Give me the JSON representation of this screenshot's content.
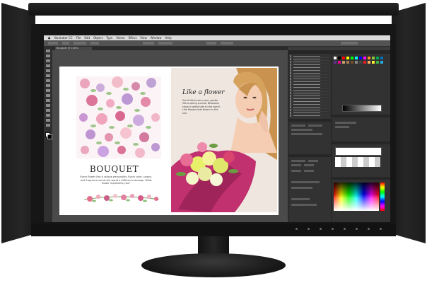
{
  "app": {
    "menu": [
      "Illustrator CC",
      "File",
      "Edit",
      "Object",
      "Type",
      "Select",
      "Effect",
      "View",
      "Window",
      "Help"
    ],
    "document_tab": "Bouquet @ 100%"
  },
  "document": {
    "left_page": {
      "title": "BOUQUET",
      "body": "Every flower has a unique personality. Every color, shape, and fragrance sends the world a different message. What flower represents you?"
    },
    "right_page": {
      "script_title": "Like a flower",
      "script_body": "You'd like to see more, gentle like a spring sunrise. Blossoms show a sweet side to the world. Like flowers that bloom in the sun."
    }
  },
  "colors": {
    "swatches": [
      "#ffffff",
      "#000000",
      "#ff0000",
      "#ffff00",
      "#00ff00",
      "#00ffff",
      "#0000ff",
      "#ff00ff",
      "#f7941d",
      "#8dc63f",
      "#00a651",
      "#0072bc",
      "#662d91",
      "#ec008c",
      "#c69c6d",
      "#a67c52",
      "#754c24",
      "#898989",
      "#464646",
      "#ed1c24",
      "#fbaf5d",
      "#f9ed32",
      "#39b54a",
      "#27aae1"
    ]
  },
  "icons": {
    "close": "close-icon",
    "menu": "menu-icon"
  }
}
